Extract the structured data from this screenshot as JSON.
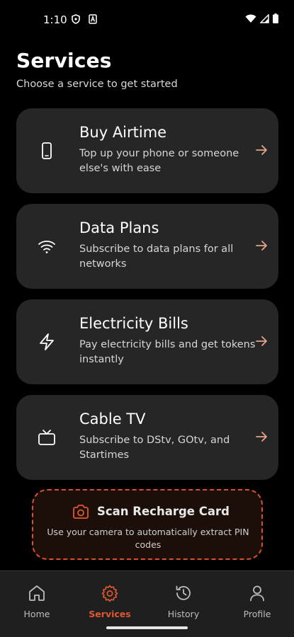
{
  "status_bar": {
    "time": "1:10",
    "icons": [
      "shield-notification-icon",
      "a-notification-icon",
      "wifi-icon",
      "signal-icon",
      "battery-icon"
    ]
  },
  "header": {
    "title": "Services",
    "subtitle": "Choose a service to get started"
  },
  "services": [
    {
      "title": "Buy Airtime",
      "description": "Top up your phone or someone else's with ease",
      "icon": "phone-icon"
    },
    {
      "title": "Data Plans",
      "description": "Subscribe to data plans for all networks",
      "icon": "wifi-icon"
    },
    {
      "title": "Electricity Bills",
      "description": "Pay electricity bills and get tokens instantly",
      "icon": "lightning-icon"
    },
    {
      "title": "Cable TV",
      "description": "Subscribe to DStv, GOtv, and Startimes",
      "icon": "tv-icon"
    }
  ],
  "scan_card": {
    "title": "Scan Recharge Card",
    "description": "Use your camera to automatically extract PIN codes",
    "icon": "camera-icon"
  },
  "bottom_nav": [
    {
      "label": "Home",
      "icon": "home-icon",
      "active": false
    },
    {
      "label": "Services",
      "icon": "gear-icon",
      "active": true
    },
    {
      "label": "History",
      "icon": "history-icon",
      "active": false
    },
    {
      "label": "Profile",
      "icon": "user-icon",
      "active": false
    }
  ],
  "colors": {
    "background": "#000000",
    "card": "#262626",
    "accent": "#e1572f",
    "arrow": "#e8a48a"
  }
}
